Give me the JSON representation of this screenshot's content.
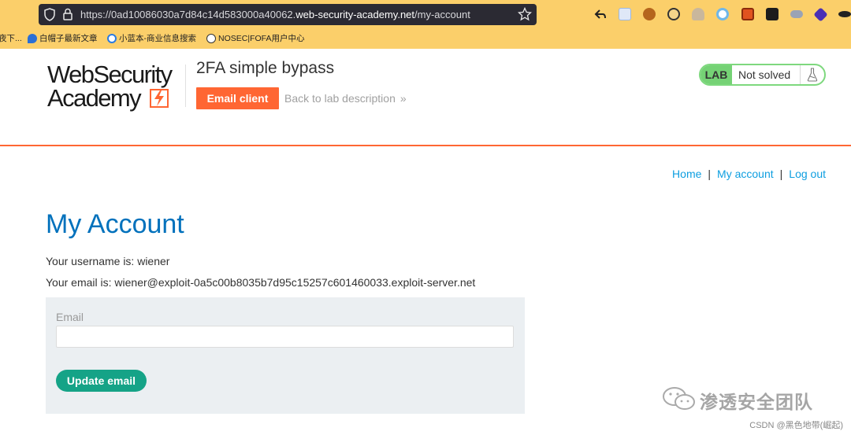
{
  "browser": {
    "url_prefix": "https://0ad10086030a7d84c14d583000a40062.",
    "url_host": "web-security-academy.net",
    "url_path": "/my-account",
    "bookmarks": [
      {
        "label": "夜下...",
        "icon": "folder-icon"
      },
      {
        "label": "白帽子最新文章",
        "icon": "drop-icon"
      },
      {
        "label": "小蓝本-商业信息搜索",
        "icon": "ring-icon"
      },
      {
        "label": "NOSEC|FOFA用户中心",
        "icon": "globe-icon"
      }
    ],
    "extension_icons": [
      "back-arrow-icon",
      "extension-icon",
      "cookie-icon",
      "cookie-editor-icon",
      "person-icon",
      "ring-icon",
      "fire-icon",
      "devtools-icon",
      "toggle-icon",
      "shape-icon",
      "hat-icon"
    ]
  },
  "header": {
    "logo_line1": "WebSecurity",
    "logo_line2": "Academy",
    "lab_title": "2FA simple bypass",
    "email_client_label": "Email client",
    "back_link_label": "Back to lab description",
    "back_chevron": "»",
    "lab_badge": "LAB",
    "lab_status": "Not solved",
    "colors": {
      "accent": "#ff6633",
      "lab_green": "#75d275",
      "link_blue": "#0d9ee0",
      "title_blue": "#0071bc",
      "button_green": "#15a387"
    }
  },
  "nav": {
    "home": "Home",
    "sep1": "|",
    "my_account": "My account",
    "sep2": "|",
    "log_out": "Log out"
  },
  "main": {
    "title": "My Account",
    "username_line": "Your username is: wiener",
    "email_line": "Your email is: wiener@exploit-0a5c00b8035b7d95c15257c601460033.exploit-server.net",
    "form": {
      "email_label": "Email",
      "email_value": "",
      "update_button": "Update email"
    }
  },
  "watermark": {
    "text": "渗透安全团队",
    "csdn": "CSDN @黑色地带(崛起)"
  }
}
